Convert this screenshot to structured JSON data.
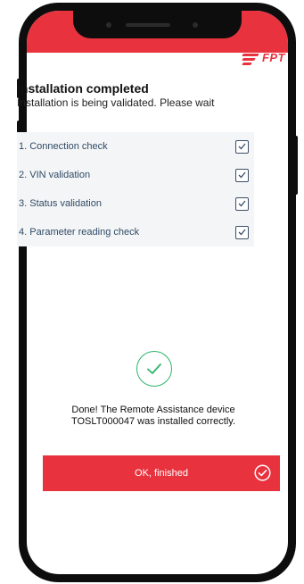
{
  "brand": {
    "name": "FPT"
  },
  "header": {
    "title": "Installation completed",
    "subtitle": "Installation is being validated. Please wait"
  },
  "checklist": {
    "items": [
      {
        "label": "1. Connection check",
        "checked": true
      },
      {
        "label": "2. VIN validation",
        "checked": true
      },
      {
        "label": "3. Status validation",
        "checked": true
      },
      {
        "label": "4. Parameter reading check",
        "checked": true
      }
    ]
  },
  "result": {
    "line1": "Done! The Remote Assistance device",
    "line2": "TOSLT000047 was installed correctly."
  },
  "actions": {
    "finish_label": "OK, finished"
  },
  "colors": {
    "accent": "#e8333f",
    "success": "#2db56b",
    "list_text": "#2f4a66"
  }
}
